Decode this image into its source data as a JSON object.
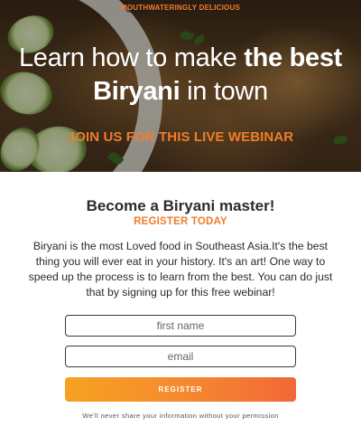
{
  "hero": {
    "tagline": "MOUTHWATERINGLY DELICIOUS",
    "headline_part1": "Learn how to make ",
    "headline_bold1": "the best Biryani",
    "headline_part2": " in town",
    "cta": "JOIN US FOR THIS LIVE WEBINAR"
  },
  "form": {
    "title": "Become a Biryani master!",
    "subtitle": "REGISTER TODAY",
    "description": "Biryani is the most Loved food in Southeast Asia.It's the best thing you will ever eat in your history. It's an art! One way to speed up the process is to learn from the best. You can do just that by signing up for this free webinar!",
    "first_name_placeholder": "first name",
    "email_placeholder": "email",
    "register_label": "REGISTER",
    "privacy_note": "We'll never share your information without your permission"
  },
  "colors": {
    "accent": "#f07d2a",
    "button_gradient_start": "#f7a223",
    "button_gradient_end": "#f26838",
    "text_dark": "#2b2b2b"
  }
}
